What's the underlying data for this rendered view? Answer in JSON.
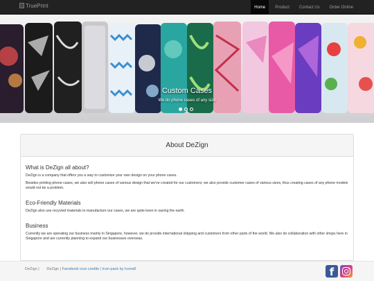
{
  "navbar": {
    "brand": "TruePrint",
    "items": [
      {
        "label": "Home",
        "active": true
      },
      {
        "label": "Product",
        "active": false
      },
      {
        "label": "Contact Us",
        "active": false
      },
      {
        "label": "Order Online",
        "active": false
      }
    ]
  },
  "carousel": {
    "caption_title": "Custom Cases",
    "caption_sub": "We do phone cases of any size",
    "slides_total": 3,
    "active_slide": 1
  },
  "about": {
    "heading": "About DeZign",
    "sections": [
      {
        "title": "What is DeZign all about?",
        "paragraphs": [
          "DeZign is a company that offers you a way to customize your own design on your phone cases.",
          "Besides printing phone cases, we also sell phone cases of various design that we've created for our customers; we also provide customer cases of various sizes, thus creating cases of any phone models would not be a problem."
        ]
      },
      {
        "title": "Eco-Friendly Materials",
        "paragraphs": [
          "DeZign also use recycled materials to manufacture our cases, we are quite keen in saving the earth."
        ]
      },
      {
        "title": "Business",
        "paragraphs": [
          "Currently we are operating our business mainly in Singapore, however, we do provide international shipping and customers from other parts of the world. We also do collaboration with other shops here in Singapore and are currently planning to expand our businesses overseas."
        ]
      }
    ]
  },
  "footer": {
    "copyright": "DeZign |",
    "brand2": "DeZign |",
    "link1": "Facebook icon credits",
    "sep": "|",
    "link2": "Icon pack by Icons8",
    "fb_glyph": "f"
  },
  "colors": {
    "navbar_bg": "#222222",
    "nav_active_bg": "#080808",
    "link": "#337ab7",
    "facebook": "#3b5998"
  },
  "icons": [
    "facebook-icon",
    "instagram-icon"
  ]
}
